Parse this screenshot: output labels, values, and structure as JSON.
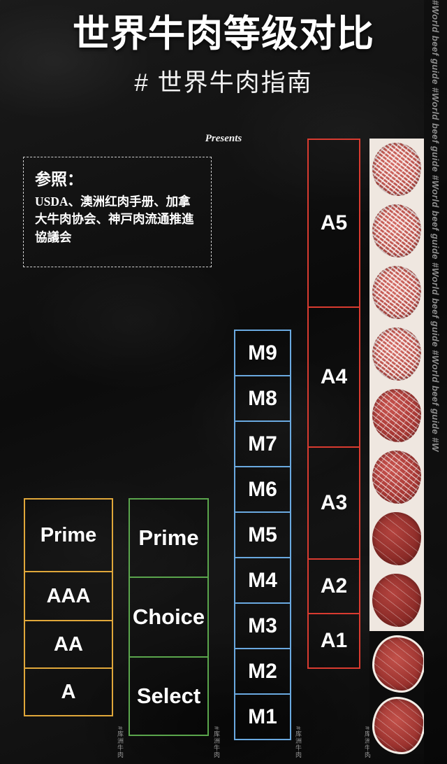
{
  "poster": {
    "title": "世界牛肉等级对比",
    "subtitle": "# 世界牛肉指南",
    "presents": "Presents",
    "watermark": "#World beef guide #World beef guide #World beef guide #World beef guide #World beef guide #W"
  },
  "reference": {
    "label": "参照：",
    "body": "USDA、澳洲红肉手册、加拿大牛肉协会、神戸肉流通推進協議会"
  },
  "columns": [
    {
      "id": "usda",
      "country_label": "#库洲牛肉",
      "accent": "#5aa54c",
      "grades": [
        "Prime",
        "Choice",
        "Select"
      ]
    },
    {
      "id": "canada",
      "country_label": "#库洲牛肉",
      "accent": "#e0a73a",
      "grades": [
        "Prime",
        "AAA",
        "AA",
        "A"
      ]
    },
    {
      "id": "australia",
      "country_label": "#库洲牛肉",
      "accent": "#6aa9e0",
      "grades": [
        "M9",
        "M8",
        "M7",
        "M6",
        "M5",
        "M4",
        "M3",
        "M2",
        "M1"
      ]
    },
    {
      "id": "japan",
      "country_label": "#库洲牛肉",
      "accent": "#d93b30",
      "grades": [
        "A5",
        "A4",
        "A3",
        "A2",
        "A1"
      ]
    }
  ],
  "photo_strip": {
    "name": "marbling-photo-strip",
    "slices": [
      "steak-a5-top",
      "steak-a5-upper",
      "steak-a5-mid",
      "steak-a5-lower",
      "steak-a4-upper",
      "steak-a4-lower",
      "steak-a3-upper",
      "steak-a3-lower",
      "steak-a2-outline",
      "steak-a1-outline"
    ]
  }
}
